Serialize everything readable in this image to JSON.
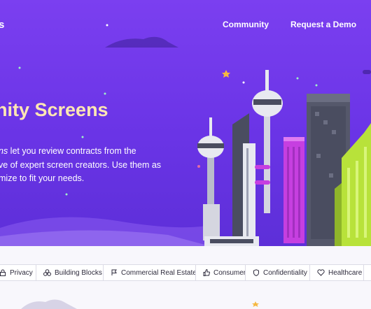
{
  "header": {
    "logo_fragment": "s",
    "nav": [
      {
        "label": "Community"
      },
      {
        "label": "Request a Demo"
      }
    ]
  },
  "hero": {
    "title": "nity Screens",
    "desc_lines": [
      {
        "em": "ns",
        "text": " let you review contracts from the"
      },
      {
        "text": "ve of expert screen creators. Use them as"
      },
      {
        "text": "mize to fit your needs."
      }
    ]
  },
  "tags": [
    {
      "label": "Privacy",
      "icon": "lock-icon"
    },
    {
      "label": "Building Blocks",
      "icon": "blocks-icon"
    },
    {
      "label": "Commercial Real Estate",
      "icon": "flag-icon"
    },
    {
      "label": "Consumer",
      "icon": "thumbs-up-icon"
    },
    {
      "label": "Confidentiality",
      "icon": "shield-icon"
    },
    {
      "label": "Healthcare",
      "icon": "heart-icon"
    }
  ],
  "colors": {
    "hero_bg": "#6a34e6",
    "title": "#ffe7b3",
    "tower_lime": "#b8e23a",
    "tower_magenta": "#c63fe0",
    "tower_grey": "#4a4d60"
  }
}
